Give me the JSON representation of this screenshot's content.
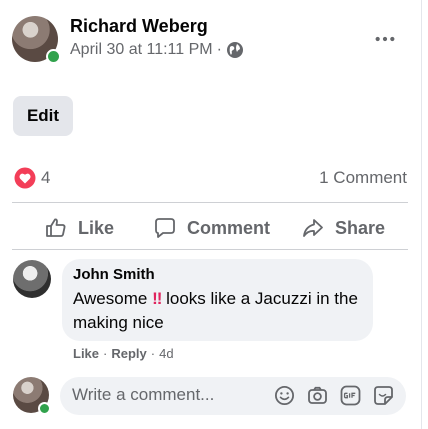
{
  "post": {
    "author": "Richard Weberg",
    "timestamp": "April 30 at 11:11 PM",
    "separator": "·",
    "privacy_icon": "globe-icon",
    "more_icon": "more-horizontal-icon"
  },
  "edit_label": "Edit",
  "stats": {
    "reaction_icon": "love-reaction-icon",
    "reaction_count": "4",
    "comment_count": "1 Comment"
  },
  "actions": {
    "like": "Like",
    "comment": "Comment",
    "share": "Share"
  },
  "comment": {
    "author": "John Smith",
    "text_before": "Awesome ",
    "text_emphasis": "!!",
    "text_after": " looks like a Jacuzzi in the making nice",
    "like_label": "Like",
    "reply_label": "Reply",
    "separator": "·",
    "age": "4d"
  },
  "composer": {
    "placeholder": "Write a comment...",
    "icons": [
      "emoji-icon",
      "camera-icon",
      "gif-icon",
      "sticker-icon"
    ]
  },
  "colors": {
    "accent_text": "#65676b",
    "online": "#31a24c",
    "love_reaction": "#f33e58",
    "emphasis": "#e0245e"
  }
}
